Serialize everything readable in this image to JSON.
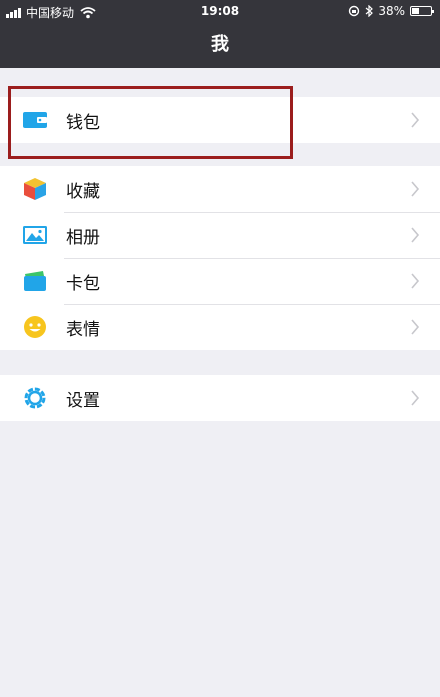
{
  "status_bar": {
    "carrier": "中国移动",
    "time": "19:08",
    "battery_percent": "38%",
    "battery_level": 0.38
  },
  "nav": {
    "title": "我"
  },
  "groups": [
    {
      "items": [
        {
          "label": "钱包",
          "icon": "wallet-icon"
        }
      ]
    },
    {
      "items": [
        {
          "label": "收藏",
          "icon": "favorites-cube-icon"
        },
        {
          "label": "相册",
          "icon": "album-photo-icon"
        },
        {
          "label": "卡包",
          "icon": "card-wallet-icon"
        },
        {
          "label": "表情",
          "icon": "smiley-face-icon"
        }
      ]
    },
    {
      "items": [
        {
          "label": "设置",
          "icon": "settings-gear-icon"
        }
      ]
    }
  ],
  "colors": {
    "bar_bg": "#35353b",
    "page_bg": "#efeff4",
    "highlight": "#9b1d1d",
    "icon_blue": "#21a5e8"
  }
}
